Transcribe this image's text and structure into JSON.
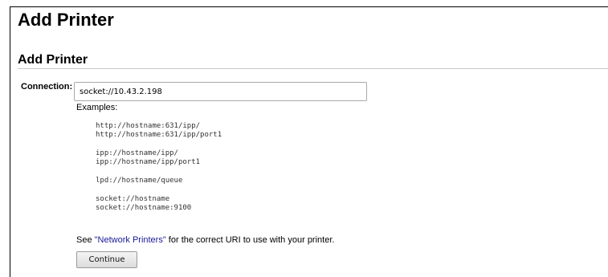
{
  "page_title": "Add Printer",
  "section_title": "Add Printer",
  "connection": {
    "label": "Connection:",
    "value": "socket://10.43.2.198"
  },
  "examples_label": "Examples:",
  "example_groups": [
    [
      "http://hostname:631/ipp/",
      "http://hostname:631/ipp/port1"
    ],
    [
      "ipp://hostname/ipp/",
      "ipp://hostname/ipp/port1"
    ],
    [
      "lpd://hostname/queue"
    ],
    [
      "socket://hostname",
      "socket://hostname:9100"
    ]
  ],
  "note": {
    "prefix": "See ",
    "link_text": "\"Network Printers\"",
    "suffix": " for the correct URI to use with your printer."
  },
  "continue_label": "Continue"
}
